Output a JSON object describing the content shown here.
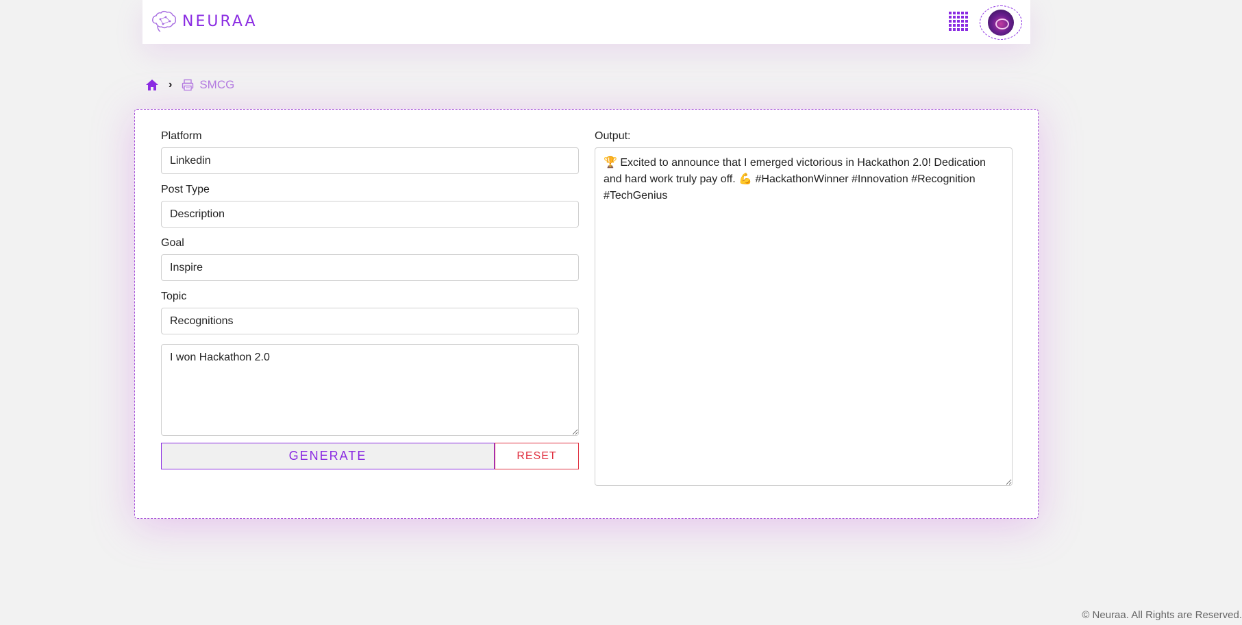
{
  "header": {
    "logo_text": "NEURAA",
    "apps_icon": "grid-icon",
    "avatar_icon": "user-avatar"
  },
  "breadcrumb": {
    "home_icon": "home-icon",
    "separator": "›",
    "current_icon": "printer-icon",
    "current_label": "SMCG"
  },
  "form": {
    "platform_label": "Platform",
    "platform_value": "Linkedin",
    "post_type_label": "Post Type",
    "post_type_value": "Description",
    "goal_label": "Goal",
    "goal_value": "Inspire",
    "topic_label": "Topic",
    "topic_value": "Recognitions",
    "prompt_value": "I won Hackathon 2.0",
    "generate_label": "GENERATE",
    "reset_label": "RESET"
  },
  "output": {
    "label": "Output:",
    "text": "🏆 Excited to announce that I emerged victorious in Hackathon 2.0! Dedication and hard work truly pay off. 💪 #HackathonWinner #Innovation #Recognition #TechGenius"
  },
  "footer": {
    "text": "© Neuraa. All Rights are Reserved."
  },
  "colors": {
    "accent": "#8a2be2",
    "reset": "#e03040",
    "breadcrumb_current": "#b37be0"
  }
}
